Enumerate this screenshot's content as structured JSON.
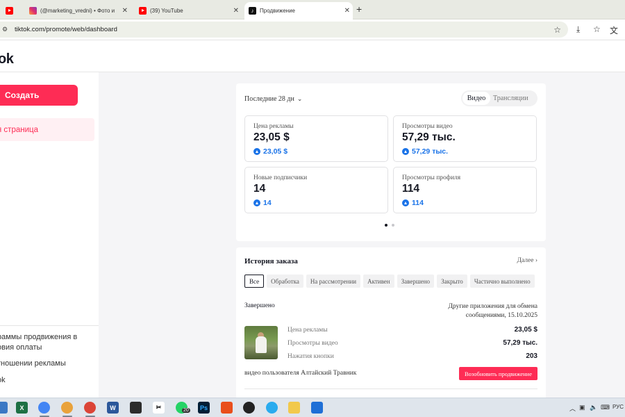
{
  "browser": {
    "tabs": [
      {
        "title": "",
        "icon": "youtube-icon"
      },
      {
        "title": "(@marketing_vredni) • Фото и",
        "icon": "instagram-icon"
      },
      {
        "title": "(39) YouTube",
        "icon": "youtube-icon"
      },
      {
        "title": "Продвижение",
        "icon": "tiktok-icon",
        "active": true
      }
    ],
    "new_tab": "+",
    "url": "tiktok.com/promote/web/dashboard"
  },
  "header": {
    "logo": "ok"
  },
  "sidebar": {
    "create_label": "Создать",
    "active_item": "я страница",
    "footer_links": [
      "раммы продвижения в\nовия оплаты",
      "тношении рекламы",
      "ok"
    ]
  },
  "stats": {
    "period": "Последние 28 дн",
    "toggle": {
      "active": "Видео",
      "inactive": "Трансляции"
    },
    "metrics": [
      {
        "label": "Цена рекламы",
        "value": "23,05 $",
        "delta": "23,05 $"
      },
      {
        "label": "Просмотры видео",
        "value": "57,29 тыс.",
        "delta": "57,29 тыс."
      },
      {
        "label": "Новые подписчики",
        "value": "14",
        "delta": "14"
      },
      {
        "label": "Просмотры профиля",
        "value": "114",
        "delta": "114"
      }
    ],
    "carousel": {
      "count": 2,
      "active": 1
    }
  },
  "orders": {
    "title": "История заказа",
    "more": "Далее",
    "filters": [
      "Все",
      "Обработка",
      "На рассмотрении",
      "Активен",
      "Завершено",
      "Закрыто",
      "Частично выполнено"
    ],
    "active_filter": "Все",
    "order": {
      "status": "Завершено",
      "placement_line1": "Другие приложения для обмена",
      "placement_line2": "сообщениями, 15.10.2025",
      "rows": [
        {
          "label": "Цена рекламы",
          "value": "23,05 $"
        },
        {
          "label": "Просмотры видео",
          "value": "57,29 тыс."
        },
        {
          "label": "Нажатия кнопки",
          "value": "203"
        }
      ],
      "caption": "видео пользователя Алтайский Травник",
      "renew_label": "Возобновить продвижение"
    }
  },
  "taskbar": {
    "badge": "20",
    "lang": "РУС"
  },
  "colors": {
    "accent": "#fe2c55",
    "link_blue": "#1a73e8"
  }
}
